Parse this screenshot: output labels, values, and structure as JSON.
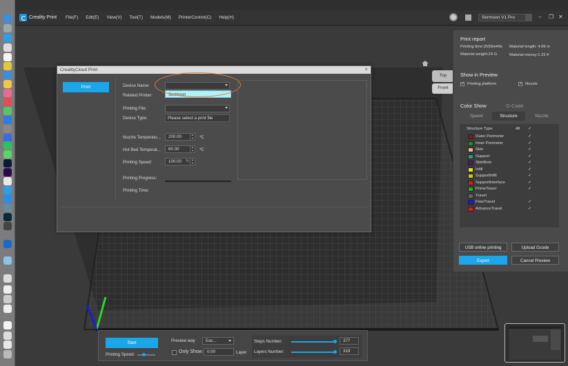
{
  "app": {
    "title": "Creality Print",
    "menu": [
      "File(F)",
      "Edit(E)",
      "View(V)",
      "Tool(T)",
      "Models(M)",
      "PrinterControl(C)",
      "Help(H)"
    ],
    "printer_model": "Sermoon V1 Pro"
  },
  "view_cube": {
    "top": "Top",
    "front": "Front"
  },
  "dialog": {
    "title": "CrealityCloud Print",
    "print_button": "Print",
    "labels": {
      "device_name": "Device Name:",
      "related_printer": "Related Printer:",
      "printing_file": "Printing File:",
      "device_type": "Device Type:",
      "nozzle_temp": "Nozzle Temperatu...",
      "bed_temp": "Hot Bed Temperat...",
      "printing_speed": "Printing Speed:",
      "printing_progress": "Printing Progress:",
      "printing_time": "Printing Time:"
    },
    "device_name_value": "",
    "device_dropdown_option": "Sermoon",
    "printing_file_value": "",
    "device_type_value": "Please select a print file",
    "nozzle_temp_value": "200.00",
    "bed_temp_value": "60.00",
    "temp_unit": "℃",
    "printing_speed_value": "100.00",
    "speed_unit": "%"
  },
  "right_panel": {
    "print_report_title": "Print report",
    "printing_time": "Printing time:2h59m49s",
    "material_length": "Material length: 4.09 m",
    "material_weight": "Material weight:24 G",
    "material_money": "Material money:1.23 ¥",
    "show_in_preview_title": "Show in Preview",
    "printing_platform": "Printing platform",
    "nozzle": "Nozzle",
    "color_show": "Color Show",
    "gcode_tab": "G-Code",
    "tabs": [
      "Speed",
      "Structure",
      "Nozzle"
    ],
    "structure_type_header": "Structure Type",
    "all_label": "All",
    "structure_types": [
      {
        "name": "Outer Perimeter",
        "color": "#7a1f1f",
        "checked": true
      },
      {
        "name": "Inner Perimeter",
        "color": "#1f8a2a",
        "checked": true
      },
      {
        "name": "Skin",
        "color": "#f1b48c",
        "checked": true
      },
      {
        "name": "Support",
        "color": "#2aa08a",
        "checked": true
      },
      {
        "name": "SkirtBrim",
        "color": "#4a1f6a",
        "checked": true
      },
      {
        "name": "Infill",
        "color": "#e6e619",
        "checked": true
      },
      {
        "name": "SupportInfill",
        "color": "#c8c81a",
        "checked": true
      },
      {
        "name": "SupportInterface",
        "color": "#d6201a",
        "checked": true
      },
      {
        "name": "PrimeTower",
        "color": "#1fb02a",
        "checked": true
      },
      {
        "name": "Travel",
        "color": "#6a6a6a",
        "checked": false
      },
      {
        "name": "FlowTravel",
        "color": "#1a1ae6",
        "checked": true
      },
      {
        "name": "AdvanceTravel",
        "color": "#e61a1a",
        "checked": true
      }
    ],
    "usb_online_printing": "USB online printing",
    "upload_gcode": "Upload Gcode",
    "export": "Export",
    "cancel_preview": "Cancel Preview"
  },
  "bottom_bar": {
    "start": "Start",
    "printing_speed": "Printing Speed:",
    "preview_way": "Preview way",
    "preview_way_value": "Eac...",
    "only_show": "Only Show",
    "only_show_value": "0.00",
    "layer": "Layer",
    "steps_number_label": "Steps Number:",
    "steps_number_value": "377",
    "layers_number_label": "Layers Number:",
    "layers_number_value": "319"
  },
  "colors": {
    "accent": "#1aa6e8",
    "highlight": "#e97b36"
  }
}
